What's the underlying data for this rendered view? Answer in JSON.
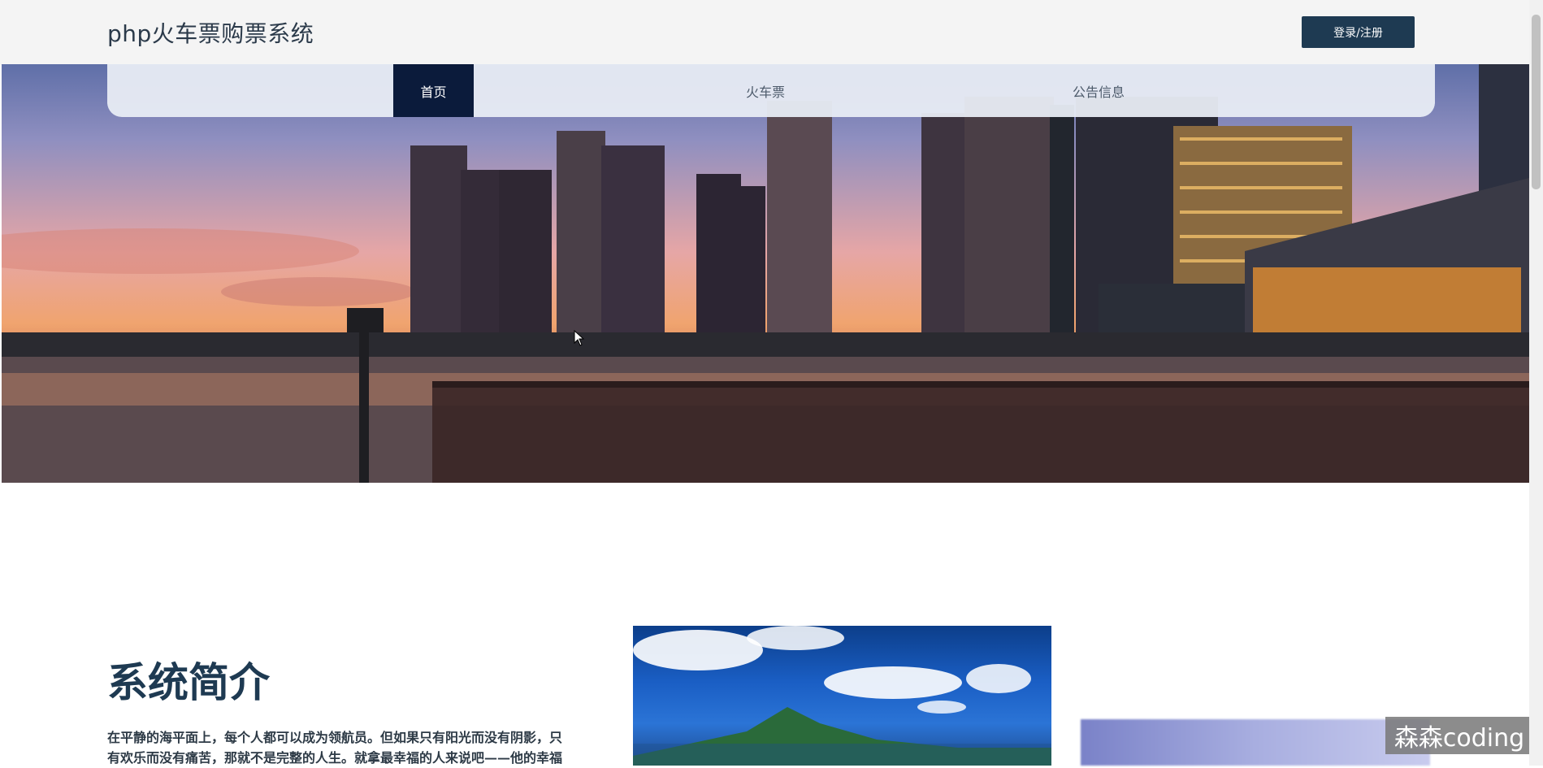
{
  "header": {
    "site_title": "php火车票购票系统",
    "login_button": "登录/注册"
  },
  "nav": {
    "items": [
      {
        "label": "首页",
        "active": true
      },
      {
        "label": "火车票",
        "active": false
      },
      {
        "label": "公告信息",
        "active": false
      }
    ]
  },
  "intro": {
    "title": "系统简介",
    "text": "在平静的海平面上，每个人都可以成为领航员。但如果只有阳光而没有阴影，只有欢乐而没有痛苦，那就不是完整的人生。就拿最幸福的人来说吧——他的幸福"
  },
  "watermark": "森森coding",
  "colors": {
    "nav_active": "#0b1b3b",
    "login_button_bg": "#1e3a52",
    "title_color": "#1e3a52"
  }
}
